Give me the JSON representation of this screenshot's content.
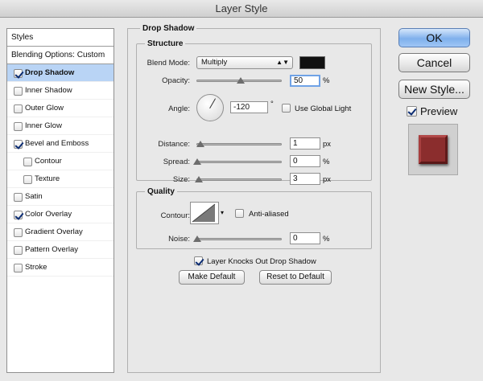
{
  "window": {
    "title": "Layer Style"
  },
  "styles_panel": {
    "header": "Styles",
    "blending_options": "Blending Options: Custom",
    "items": [
      {
        "label": "Drop Shadow",
        "checked": true,
        "selected": true,
        "indent": false
      },
      {
        "label": "Inner Shadow",
        "checked": false,
        "selected": false,
        "indent": false
      },
      {
        "label": "Outer Glow",
        "checked": false,
        "selected": false,
        "indent": false
      },
      {
        "label": "Inner Glow",
        "checked": false,
        "selected": false,
        "indent": false
      },
      {
        "label": "Bevel and Emboss",
        "checked": true,
        "selected": false,
        "indent": false
      },
      {
        "label": "Contour",
        "checked": false,
        "selected": false,
        "indent": true
      },
      {
        "label": "Texture",
        "checked": false,
        "selected": false,
        "indent": true
      },
      {
        "label": "Satin",
        "checked": false,
        "selected": false,
        "indent": false
      },
      {
        "label": "Color Overlay",
        "checked": true,
        "selected": false,
        "indent": false
      },
      {
        "label": "Gradient Overlay",
        "checked": false,
        "selected": false,
        "indent": false
      },
      {
        "label": "Pattern Overlay",
        "checked": false,
        "selected": false,
        "indent": false
      },
      {
        "label": "Stroke",
        "checked": false,
        "selected": false,
        "indent": false
      }
    ]
  },
  "drop_shadow": {
    "title": "Drop Shadow",
    "structure": {
      "title": "Structure",
      "blend_mode_label": "Blend Mode:",
      "blend_mode_value": "Multiply",
      "shadow_color": "#111111",
      "opacity_label": "Opacity:",
      "opacity_value": "50",
      "opacity_unit": "%",
      "angle_label": "Angle:",
      "angle_value": "-120",
      "angle_unit": "°",
      "use_global_light_label": "Use Global Light",
      "use_global_light_checked": false,
      "distance_label": "Distance:",
      "distance_value": "1",
      "distance_unit": "px",
      "spread_label": "Spread:",
      "spread_value": "0",
      "spread_unit": "%",
      "size_label": "Size:",
      "size_value": "3",
      "size_unit": "px"
    },
    "quality": {
      "title": "Quality",
      "contour_label": "Contour:",
      "anti_aliased_label": "Anti-aliased",
      "anti_aliased_checked": false,
      "noise_label": "Noise:",
      "noise_value": "0",
      "noise_unit": "%"
    },
    "knocks_out_label": "Layer Knocks Out Drop Shadow",
    "knocks_out_checked": true,
    "make_default_label": "Make Default",
    "reset_default_label": "Reset to Default"
  },
  "actions": {
    "ok_label": "OK",
    "cancel_label": "Cancel",
    "new_style_label": "New Style...",
    "preview_label": "Preview",
    "preview_checked": true
  },
  "preview_color": "#8b2d2d"
}
